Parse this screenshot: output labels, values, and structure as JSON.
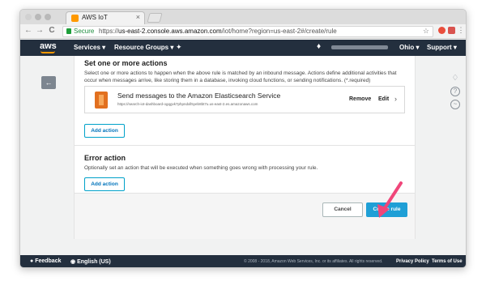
{
  "browser": {
    "tab_title": "AWS IoT",
    "tab_close": "×",
    "secure_label": "Secure",
    "url_prefix": "https://",
    "url_host": "us-east-2.console.aws.amazon.com",
    "url_path": "/iot/home?region=us-east-2#/create/rule",
    "back": "←",
    "forward": "→",
    "reload": "C",
    "bookmark": "☆",
    "menu": "⋮",
    "icons": [
      "lock-icon",
      "star-icon",
      "extension-icon"
    ]
  },
  "awsnav": {
    "logo": "aws",
    "services": "Services",
    "resource_groups": "Resource Groups",
    "pin": "✦",
    "bell": "🔔",
    "region": "Ohio",
    "support": "Support",
    "caret": "▾"
  },
  "side": {
    "back": "←",
    "icons": [
      "bell-icon",
      "help-icon",
      "activity-icon"
    ],
    "bell": "♢",
    "help": "?",
    "activity": "~"
  },
  "actions_section": {
    "title": "Set one or more actions",
    "description": "Select one or more actions to happen when the above rule is matched by an inbound message. Actions define additional activities that occur when messages arrive, like storing them in a database, invoking cloud functions, or sending notifications. (*.required)",
    "action": {
      "title": "Send messages to the Amazon Elasticsearch Service",
      "endpoint": "https://search-iot-dashboard-ogqgvk7phpndxll5yeb8bt7u.us-east-2.es.amazonaws.com",
      "remove": "Remove",
      "edit": "Edit",
      "chevron": "›"
    },
    "add_button": "Add action"
  },
  "error_section": {
    "title": "Error action",
    "description": "Optionally set an action that will be executed when something goes wrong with processing your rule.",
    "add_button": "Add action"
  },
  "form_buttons": {
    "cancel": "Cancel",
    "create": "Create rule"
  },
  "footer": {
    "feedback": "Feedback",
    "language": "English (US)",
    "copyright": "© 2008 - 2018, Amazon Web Services, Inc. or its affiliates. All rights reserved.",
    "privacy": "Privacy Policy",
    "terms": "Terms of Use"
  },
  "colors": {
    "aws_nav": "#232f3e",
    "accent_orange": "#ff9900",
    "primary_button": "#1f9fd6",
    "pointer_arrow": "#f0467a"
  }
}
